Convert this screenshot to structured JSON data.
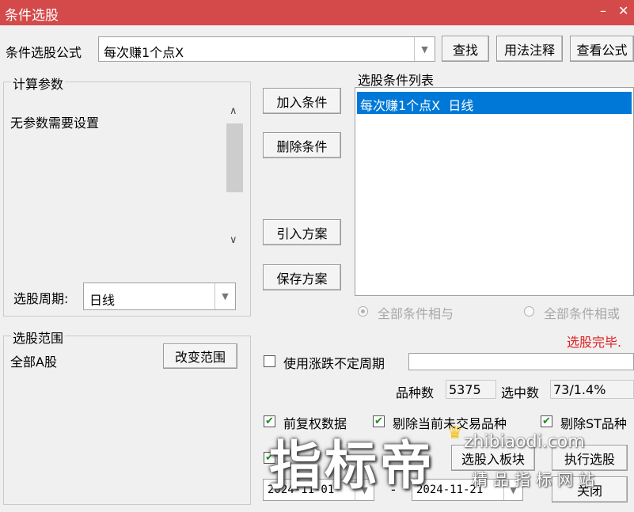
{
  "window": {
    "title": "条件选股",
    "minimize_glyph": "–",
    "close_glyph": "✕"
  },
  "formula": {
    "label": "条件选股公式",
    "value": "每次赚1个点X",
    "find_button": "查找",
    "usage_button": "用法注释",
    "view_button": "查看公式"
  },
  "params": {
    "group_label": "计算参数",
    "message": "无参数需要设置",
    "period_label": "选股周期:",
    "period_value": "日线"
  },
  "actions": {
    "add": "加入条件",
    "delete": "删除条件",
    "import": "引入方案",
    "save": "保存方案"
  },
  "conditions": {
    "header": "选股条件列表",
    "items": [
      "每次赚1个点X  日线"
    ],
    "logic_and": "全部条件相与",
    "logic_or": "全部条件相或",
    "selected_logic": "and",
    "status": "选股完毕."
  },
  "range": {
    "group_label": "选股范围",
    "value": "全部A股",
    "change_button": "改变范围"
  },
  "variable_period": {
    "label": "使用涨跌不定周期",
    "checked": false
  },
  "stats": {
    "count_label": "品种数",
    "count_value": "5375",
    "selected_label": "选中数",
    "selected_value": "73/1.4%"
  },
  "options": {
    "pre_adjust": {
      "label": "前复权数据",
      "checked": true
    },
    "exclude_untraded": {
      "label": "剔除当前未交易品种",
      "checked": true
    },
    "exclude_st": {
      "label": "剔除ST品种",
      "checked": true
    },
    "time_range_checked": true
  },
  "date_range": {
    "start": "2024-11-01",
    "separator": "-",
    "end": "2024-11-21"
  },
  "bottom_buttons": {
    "to_block": "选股入板块",
    "execute": "执行选股",
    "close": "关闭"
  },
  "watermark": {
    "brand": "指标帝",
    "domain": "zhibiaodi.com",
    "slogan": "精品指标网站"
  },
  "colors": {
    "titlebar": "#d44a4a",
    "selection": "#0078d7",
    "status_red": "#e02020",
    "checkmark": "#1a8a1a"
  }
}
